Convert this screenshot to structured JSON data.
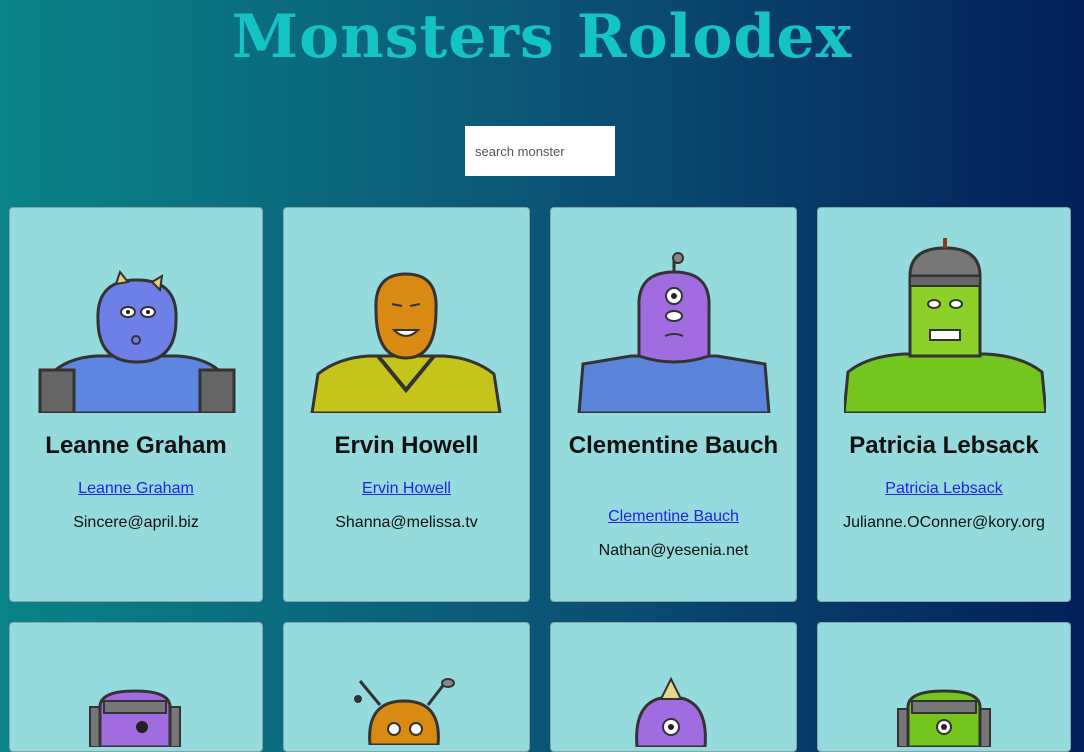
{
  "app": {
    "title": "Monsters Rolodex"
  },
  "search": {
    "placeholder": "search monster",
    "value": ""
  },
  "monsters": [
    {
      "name": "Leanne Graham",
      "link": "Leanne Graham",
      "email": "Sincere@april.biz",
      "colors": {
        "skin": "#6f7fe8",
        "body": "#5d86e0"
      }
    },
    {
      "name": "Ervin Howell",
      "link": "Ervin Howell",
      "email": "Shanna@melissa.tv",
      "colors": {
        "skin": "#d98a12",
        "body": "#c4c41a"
      }
    },
    {
      "name": "Clementine Bauch",
      "link": "Clementine Bauch",
      "email": "Nathan@yesenia.net",
      "colors": {
        "skin": "#a16ce0",
        "body": "#5b83d9"
      }
    },
    {
      "name": "Patricia Lebsack",
      "link": "Patricia Lebsack",
      "email": "Julianne.OConner@kory.org",
      "colors": {
        "skin": "#8cd12a",
        "body": "#74c61e"
      }
    }
  ],
  "theme": {
    "card_bg": "#95dadc",
    "title_color": "#14c4c4",
    "link_color": "#2323e0"
  }
}
